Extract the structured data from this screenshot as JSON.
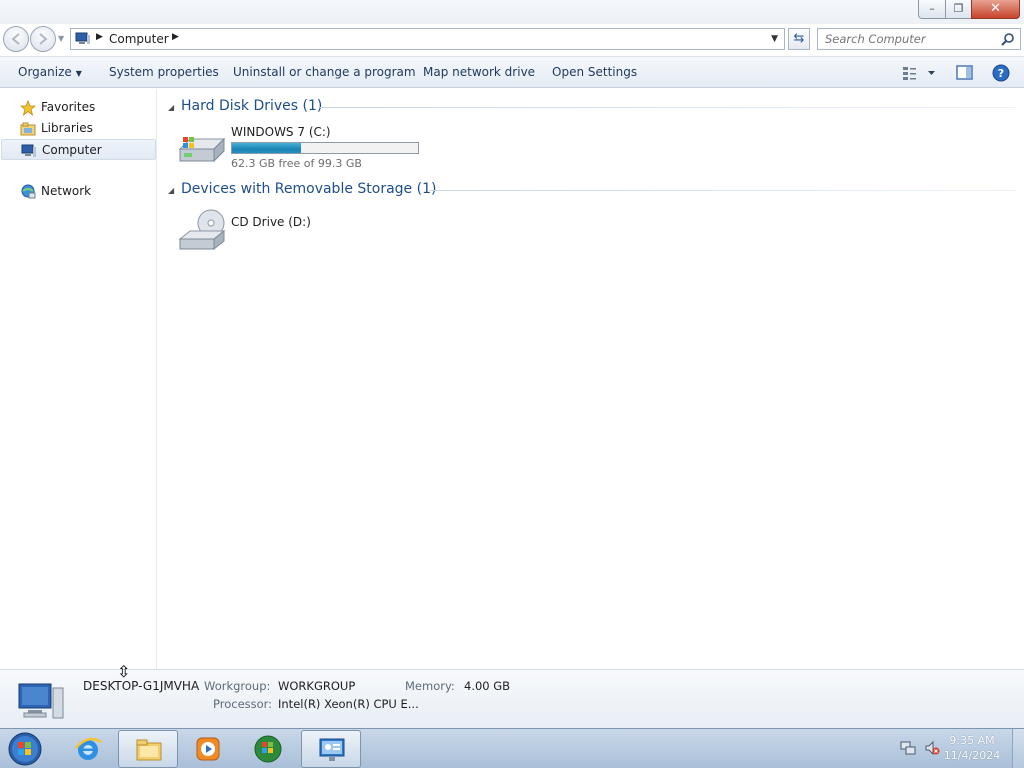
{
  "window": {
    "buttons": {
      "minimize": "–",
      "maximize": "❐",
      "close": "✕"
    },
    "address": {
      "location": "Computer"
    },
    "search": {
      "placeholder": "Search Computer"
    },
    "commandbar": {
      "organize": "Organize",
      "system_properties": "System properties",
      "uninstall": "Uninstall or change a program",
      "map_drive": "Map network drive",
      "open_settings": "Open Settings"
    },
    "navpane": {
      "favorites": "Favorites",
      "libraries": "Libraries",
      "computer": "Computer",
      "network": "Network"
    },
    "content": {
      "hdd_group": "Hard Disk Drives (1)",
      "removable_group": "Devices with Removable Storage (1)",
      "drives": [
        {
          "name": "WINDOWS 7 (C:)",
          "free_text": "62.3 GB free of 99.3 GB",
          "used_fraction": 0.373
        },
        {
          "name": "CD Drive (D:)"
        }
      ]
    },
    "details": {
      "computer_name": "DESKTOP-G1JMVHA",
      "workgroup_label": "Workgroup:",
      "workgroup_value": "WORKGROUP",
      "memory_label": "Memory:",
      "memory_value": "4.00 GB",
      "processor_label": "Processor:",
      "processor_value": "Intel(R) Xeon(R) CPU E..."
    }
  },
  "taskbar": {
    "items": [
      "start-orb",
      "internet-explorer",
      "windows-explorer",
      "media-player",
      "windows-orb",
      "system-settings"
    ],
    "clock_time": "9:35 AM",
    "clock_date": "11/4/2024"
  },
  "colors": {
    "accent_blue": "#1e4e8c",
    "progress_fill": "#1c84b5",
    "close_red": "#c7442b"
  }
}
